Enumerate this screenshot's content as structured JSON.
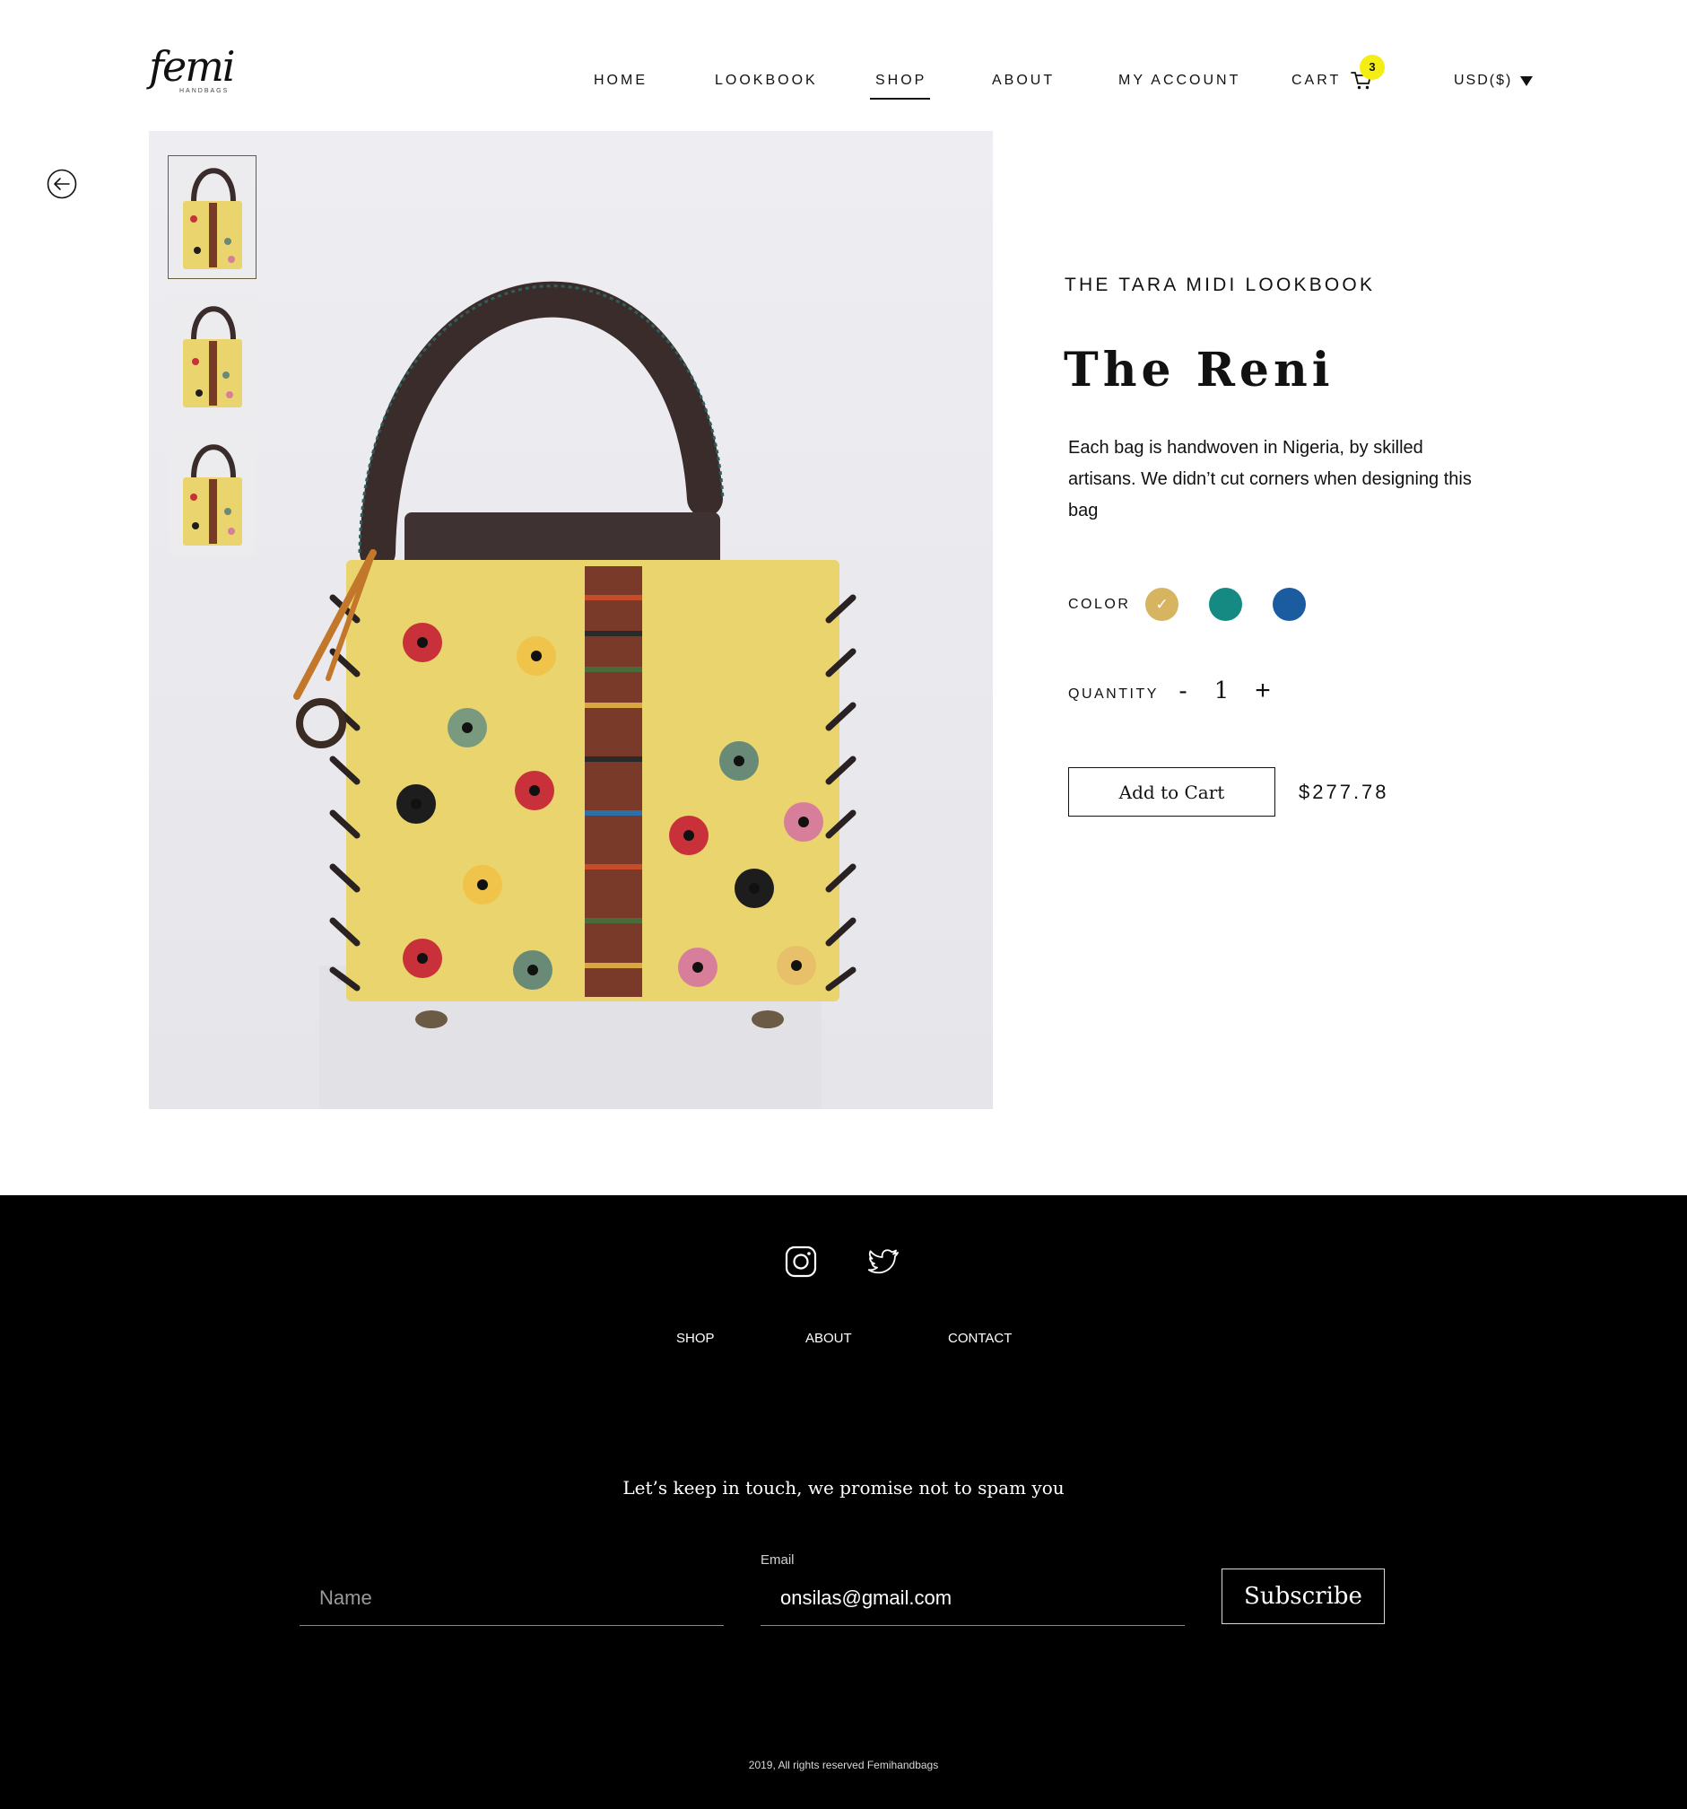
{
  "brand": {
    "logo_text": "femi",
    "logo_subtext": "HANDBAGS"
  },
  "nav": {
    "items": [
      "HOME",
      "LOOKBOOK",
      "SHOP",
      "ABOUT",
      "MY ACCOUNT"
    ],
    "active": "SHOP",
    "cart_label": "CART",
    "cart_count": "3",
    "currency": "USD($)"
  },
  "gallery": {
    "thumbnails_count": 3,
    "selected_thumbnail": 1
  },
  "product": {
    "collection": "THE TARA MIDI LOOKBOOK",
    "title": "The Reni",
    "description": "Each bag is handwoven in Nigeria, by skilled artisans. We didn’t cut corners when designing this bag",
    "color_label": "COLOR",
    "colors": [
      "#d6b460",
      "#148a82",
      "#1b5ca0"
    ],
    "selected_color": 0,
    "quantity_label": "QUANTITY",
    "quantity_minus": "-",
    "quantity": "1",
    "quantity_plus": "+",
    "add_to_cart_label": "Add to Cart",
    "price": "$277.78"
  },
  "footer": {
    "social": [
      "instagram-icon",
      "twitter-icon"
    ],
    "links": [
      "SHOP",
      "ABOUT",
      "CONTACT"
    ],
    "tagline": "Let’s keep in touch, we promise not to spam you",
    "name_placeholder": "Name",
    "email_label": "Email",
    "email_value": "onsilas@gmail.com",
    "subscribe_label": "Subscribe",
    "copyright": "2019, All rights reserved Femihandbags"
  },
  "colors": {
    "badge": "#f5ee14",
    "footer_bg": "#000000",
    "bag_body": "#ead46e"
  }
}
